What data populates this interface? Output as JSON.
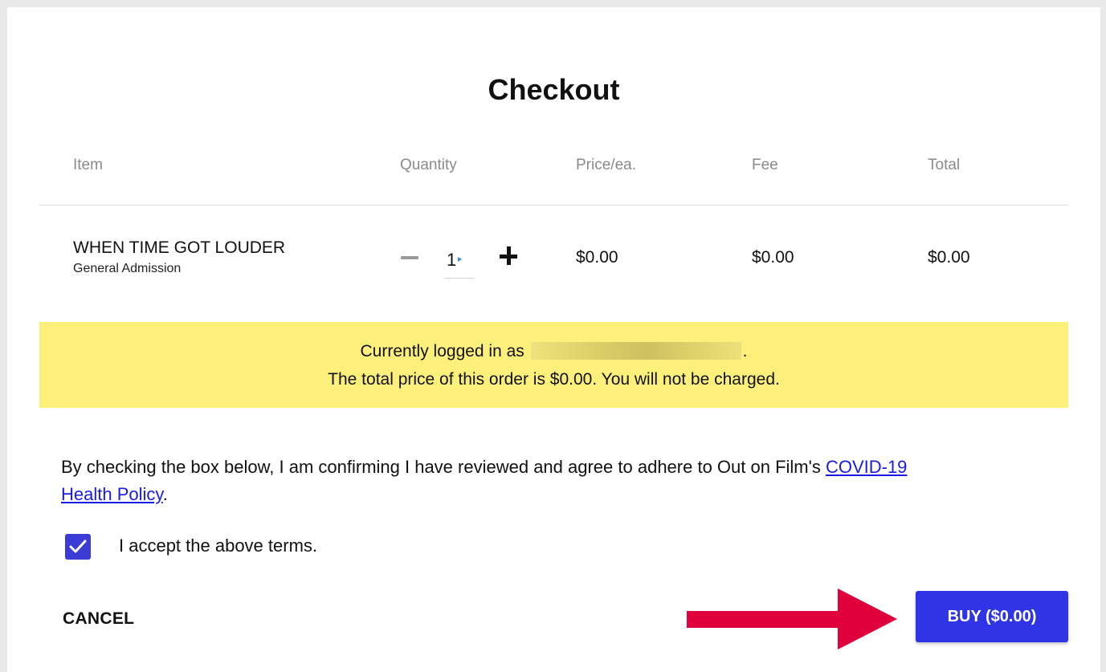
{
  "page": {
    "title": "Checkout"
  },
  "table": {
    "headers": {
      "item": "Item",
      "quantity": "Quantity",
      "price": "Price/ea.",
      "fee": "Fee",
      "total": "Total"
    },
    "rows": [
      {
        "name": "WHEN TIME GOT LOUDER",
        "ticket_type": "General Admission",
        "quantity": "1",
        "price": "$0.00",
        "fee": "$0.00",
        "total": "$0.00"
      }
    ]
  },
  "notice": {
    "logged_in_prefix": "Currently logged in as",
    "logged_in_suffix": ".",
    "total_message": "The total price of this order is $0.00. You will not be charged.",
    "background_color": "#fdf07a"
  },
  "policy": {
    "text_before": "By checking the box below, I am confirming I have reviewed and agree to adhere to Out on Film's ",
    "link_text_1": "COVID-19",
    "link_text_2": "Health Policy",
    "text_after": "."
  },
  "terms": {
    "checked": true,
    "label": "I accept the above terms."
  },
  "actions": {
    "cancel_label": "CANCEL",
    "buy_label": "BUY ($0.00)",
    "buy_color": "#2f34e6",
    "arrow_color": "#e0003c"
  },
  "icons": {
    "qty_decrement": "minus-icon",
    "qty_increment": "plus-icon",
    "checkbox": "checkmark-icon",
    "pointer": "arrow-right-icon"
  }
}
